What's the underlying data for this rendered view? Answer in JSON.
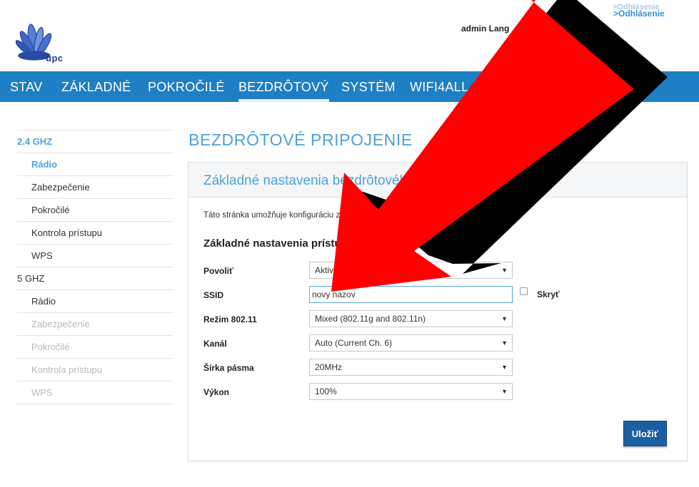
{
  "header": {
    "logo_text": "upc",
    "user_text": "admin Lang",
    "logout_ghost": ">Odhlásenie",
    "logout_label": ">Odhlásenie"
  },
  "nav": {
    "items": [
      "STAV",
      "ZÁKLADNÉ",
      "POKROČILÉ",
      "BEZDRÔTOVÝ",
      "SYSTÉM",
      "WIFI4ALL"
    ],
    "active": "BEZDRÔTOVÝ"
  },
  "sidebar": {
    "group1": "2.4 GHZ",
    "group1_items": [
      "Rádio",
      "Zabezpečenie",
      "Pokročilé",
      "Kontrola prístupu",
      "WPS"
    ],
    "group2": "5 GHZ",
    "group2_items": [
      "Rádio",
      "Zabezpečenie",
      "Pokročilé",
      "Kontrola prístupu",
      "WPS"
    ]
  },
  "page": {
    "title": "BEZDRÔTOVÉ PRIPOJENIE",
    "panel_title": "Základné nastavenia bezdrôtového pripojenia 2.4GHz",
    "description": "Táto stránka umožňuje konfiguráciu základných nastavení bezdrôtového pripojenia",
    "section_title": "Základné nastavenia prístupového bodu 2.4GHz"
  },
  "form": {
    "enable_label": "Povoliť",
    "enable_value": "Aktivovať",
    "ssid_label": "SSID",
    "ssid_value": "novy nazov",
    "hide_label": "Skryť",
    "mode_label": "Režim 802.11",
    "mode_value": "Mixed (802.11g and 802.11n)",
    "channel_label": "Kanál",
    "channel_value": "Auto (Current Ch. 6)",
    "bandwidth_label": "Šírka pásma",
    "bandwidth_value": "20MHz",
    "power_label": "Výkon",
    "power_value": "100%",
    "save_label": "Uložiť"
  },
  "colors": {
    "nav_bg": "#1f7fc4",
    "accent": "#4ea1d7",
    "button": "#1b5ea2",
    "overlay_arrow": "#ff0000"
  }
}
